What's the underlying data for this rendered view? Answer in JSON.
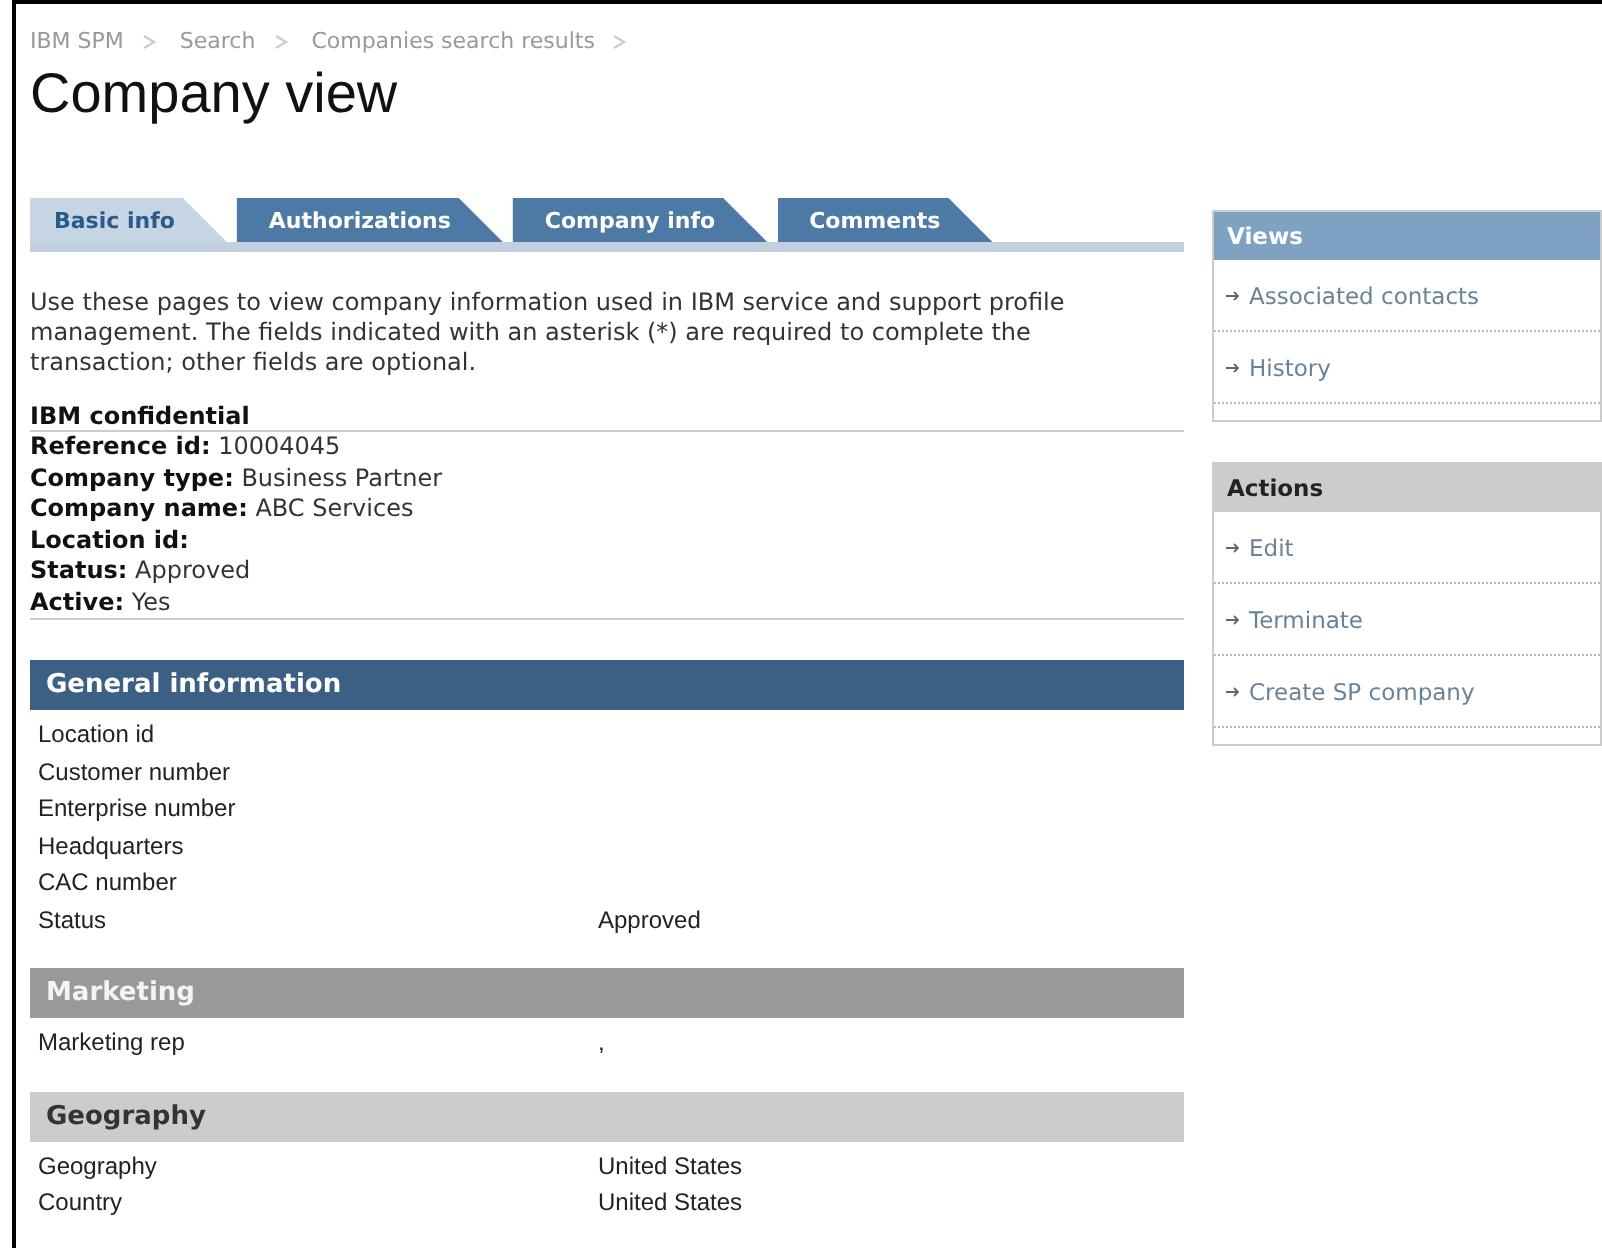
{
  "breadcrumb": [
    "IBM SPM",
    "Search",
    "Companies search results"
  ],
  "title": "Company view",
  "tabs": [
    {
      "label": "Basic info",
      "selected": true
    },
    {
      "label": "Authorizations",
      "selected": false
    },
    {
      "label": "Company info",
      "selected": false
    },
    {
      "label": "Comments",
      "selected": false
    }
  ],
  "intro": "Use these pages to view company information used in IBM service and support profile management. The fields indicated with an asterisk (*) are required to complete the transaction; other fields are optional.",
  "summary": {
    "heading": "IBM confidential",
    "fields": [
      {
        "label": "Reference id:",
        "value": "10004045"
      },
      {
        "label": "Company type:",
        "value": "Business Partner"
      },
      {
        "label": "Company name:",
        "value": "ABC Services"
      },
      {
        "label": "Location id:"
      },
      {
        "label": "Status:",
        "value": "Approved"
      },
      {
        "label": "Active:",
        "value": "Yes"
      }
    ]
  },
  "sections": [
    {
      "title": "General information",
      "kind": "primary",
      "rows": [
        {
          "label": "Location id"
        },
        {
          "label": "Customer number"
        },
        {
          "label": "Enterprise number"
        },
        {
          "label": "Headquarters"
        },
        {
          "label": "CAC number"
        },
        {
          "label": "Status",
          "value": "Approved"
        }
      ]
    },
    {
      "title": "Marketing",
      "kind": "secondary",
      "rows": [
        {
          "label": "Marketing rep",
          "value": ","
        }
      ]
    },
    {
      "title": "Geography",
      "kind": "tertiary",
      "rows": [
        {
          "label": "Geography",
          "value": "United States"
        },
        {
          "label": "Country",
          "value": "United States"
        }
      ]
    }
  ],
  "sidebar": [
    {
      "title": "Views",
      "kind": "primary",
      "items": [
        "Associated contacts",
        "History"
      ]
    },
    {
      "title": "Actions",
      "kind": "secondary",
      "items": [
        "Edit",
        "Terminate",
        "Create SP company"
      ]
    }
  ]
}
